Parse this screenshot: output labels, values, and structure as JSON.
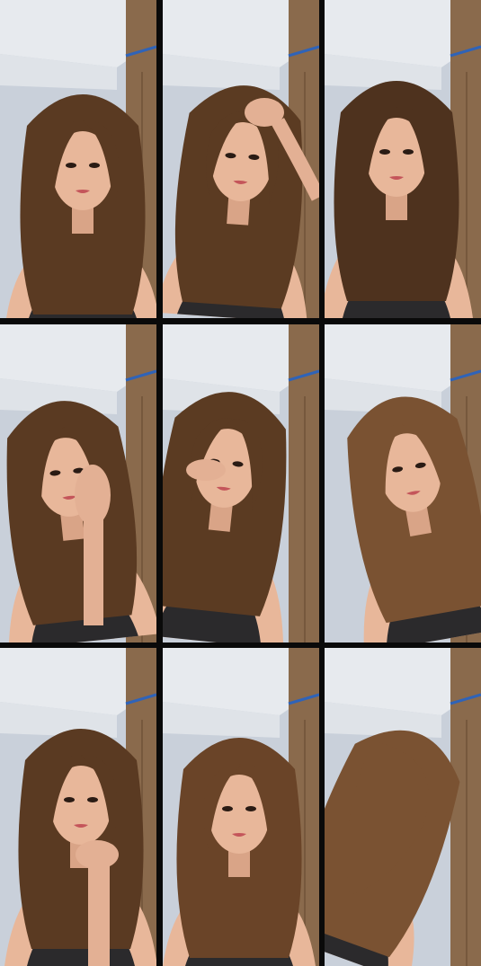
{
  "collage": {
    "rows": 3,
    "columns": 3,
    "tiles": [
      {
        "scene": "portrait-front-hair-down",
        "hair_color": "#5a3a22"
      },
      {
        "scene": "portrait-hand-in-hair",
        "hair_color": "#5b3b22"
      },
      {
        "scene": "portrait-looking-down",
        "hair_color": "#4e321e"
      },
      {
        "scene": "portrait-hand-on-cheek",
        "hair_color": "#5a3a22"
      },
      {
        "scene": "portrait-hand-at-eye",
        "hair_color": "#5b3b22"
      },
      {
        "scene": "portrait-hair-tossed",
        "hair_color": "#7a5232"
      },
      {
        "scene": "portrait-chin-on-hand",
        "hair_color": "#5a3a22"
      },
      {
        "scene": "portrait-voluminous-hair",
        "hair_color": "#6a4428"
      },
      {
        "scene": "portrait-hair-covering-face",
        "hair_color": "#7a5232"
      }
    ]
  },
  "colors": {
    "frame": "#0a0a0a",
    "ceiling": "#e7eaee",
    "wall": "#c9d0da",
    "cabinet": "#8a6a4c",
    "cabinet_trim": "#2f63b8",
    "skin": "#e8b79a",
    "top": "#2b2a2c"
  }
}
